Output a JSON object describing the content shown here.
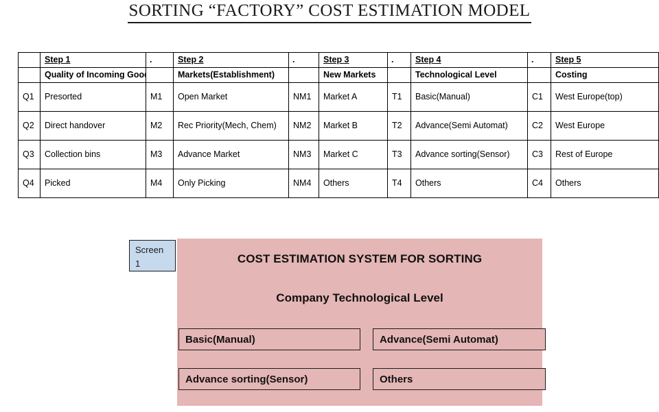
{
  "document": {
    "title": "SORTING “FACTORY” COST ESTIMATION MODEL"
  },
  "table": {
    "step_headers": [
      {
        "label": "Step 1",
        "name": "Quality of Incoming Goods"
      },
      {
        "label": "Step 2",
        "name": "Markets(Establishment)"
      },
      {
        "label": "Step 3",
        "name": "New Markets"
      },
      {
        "label": "Step 4",
        "name": "Technological Level"
      },
      {
        "label": "Step 5",
        "name": "Costing"
      }
    ],
    "separator_label": ".",
    "rows": [
      {
        "q_code": "Q1",
        "q_value": "Presorted",
        "m_code": "M1",
        "m_value": "Open Market",
        "nm_code": "NM1",
        "nm_value": "Market A",
        "t_code": "T1",
        "t_value": "Basic(Manual)",
        "c_code": "C1",
        "c_value": "West Europe(top)"
      },
      {
        "q_code": "Q2",
        "q_value": "Direct handover",
        "m_code": "M2",
        "m_value": "Rec Priority(Mech, Chem)",
        "nm_code": "NM2",
        "nm_value": "Market B",
        "t_code": "T2",
        "t_value": "Advance(Semi Automat)",
        "c_code": "C2",
        "c_value": "West Europe"
      },
      {
        "q_code": "Q3",
        "q_value": "Collection bins",
        "m_code": "M3",
        "m_value": "Advance Market",
        "nm_code": "NM3",
        "nm_value": "Market C",
        "t_code": "T3",
        "t_value": "Advance sorting(Sensor)",
        "c_code": "C3",
        "c_value": "Rest of Europe"
      },
      {
        "q_code": "Q4",
        "q_value": "Picked",
        "m_code": "M4",
        "m_value": "Only Picking",
        "nm_code": "NM4",
        "nm_value": "Others",
        "t_code": "T4",
        "t_value": "Others",
        "c_code": "C4",
        "c_value": "Others"
      }
    ]
  },
  "screen": {
    "tag_line1": "Screen",
    "tag_line2": "1",
    "heading": "COST ESTIMATION SYSTEM FOR SORTING",
    "subheading": "Company Technological Level",
    "options": [
      {
        "label": "Basic(Manual)"
      },
      {
        "label": "Advance(Semi Automat)"
      },
      {
        "label": "Advance sorting(Sensor)"
      },
      {
        "label": "Others"
      }
    ]
  },
  "colors": {
    "panel_pink": "#e5b6b6",
    "tag_blue": "#c6d9ed",
    "border_dark": "#1b1b1b"
  }
}
